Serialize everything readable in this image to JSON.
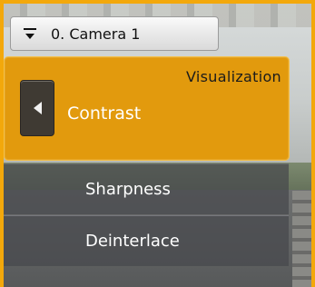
{
  "camera": {
    "label": "0. Camera 1"
  },
  "menu": {
    "title": "Visualization",
    "current": "Contrast",
    "items": [
      {
        "label": "Sharpness"
      },
      {
        "label": "Deinterlace"
      }
    ]
  },
  "colors": {
    "accent": "#e29a0d",
    "border": "#f3a80b"
  },
  "icons": {
    "camera_menu": "menu-dropdown-icon",
    "back": "triangle-left-icon"
  }
}
